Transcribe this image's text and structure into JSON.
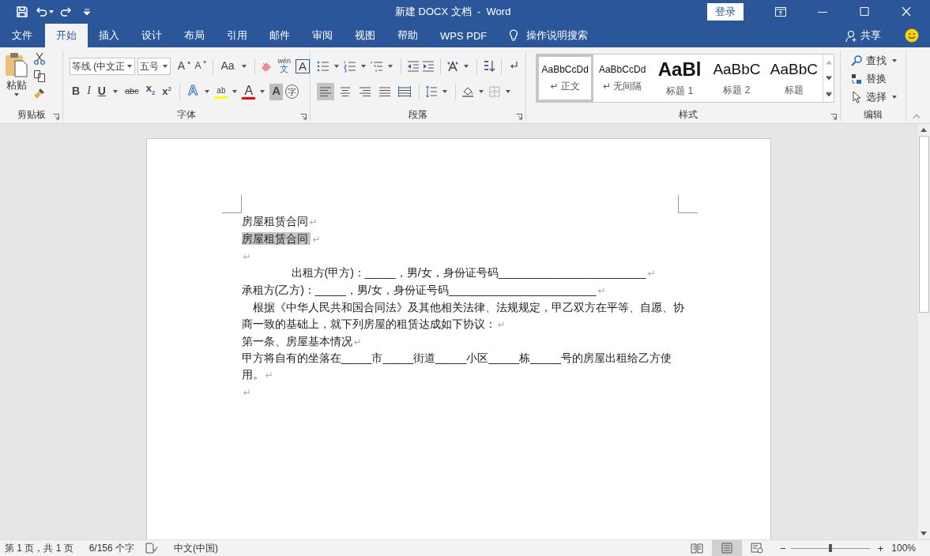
{
  "title_bar": {
    "title": "新建 DOCX 文档  -  Word",
    "login_button": "登录"
  },
  "ribbon_tabs": [
    {
      "label": "文件",
      "selected": false
    },
    {
      "label": "开始",
      "selected": true
    },
    {
      "label": "插入",
      "selected": false
    },
    {
      "label": "设计",
      "selected": false
    },
    {
      "label": "布局",
      "selected": false
    },
    {
      "label": "引用",
      "selected": false
    },
    {
      "label": "邮件",
      "selected": false
    },
    {
      "label": "审阅",
      "selected": false
    },
    {
      "label": "视图",
      "selected": false
    },
    {
      "label": "帮助",
      "selected": false
    },
    {
      "label": "WPS PDF",
      "selected": false
    }
  ],
  "tell_me": "操作说明搜索",
  "share": "共享",
  "clipboard": {
    "paste": "粘贴",
    "group": "剪贴板"
  },
  "font": {
    "name": "等线 (中文正",
    "size": "五号",
    "group": "字体",
    "row1": [
      {
        "kind": "grow",
        "glyph": "A"
      },
      {
        "kind": "shrink",
        "glyph": "A"
      },
      {
        "kind": "case",
        "glyph": "Aa"
      },
      {
        "kind": "clear"
      },
      {
        "kind": "phonetic",
        "glyph": "wén",
        "sub": "文"
      },
      {
        "kind": "border",
        "glyph": "A"
      }
    ],
    "row2": [
      {
        "kind": "bold",
        "glyph": "B"
      },
      {
        "kind": "italic",
        "glyph": "I"
      },
      {
        "kind": "underline",
        "glyph": "U"
      },
      {
        "kind": "strike",
        "glyph": "abc"
      },
      {
        "kind": "sub",
        "glyph": "x",
        "sub": "2"
      },
      {
        "kind": "sup",
        "glyph": "x",
        "sup": "2"
      },
      {
        "kind": "effects",
        "glyph": "A"
      },
      {
        "kind": "highlight",
        "glyph": "ab",
        "color": "#ffff00"
      },
      {
        "kind": "color",
        "glyph": "A",
        "color": "#ff0000"
      },
      {
        "kind": "shading",
        "glyph": "A"
      },
      {
        "kind": "enclose",
        "glyph": "字"
      }
    ]
  },
  "paragraph": {
    "group": "段落",
    "alignment": [
      {
        "kind": "left",
        "selected": true
      },
      {
        "kind": "center",
        "selected": false
      },
      {
        "kind": "right",
        "selected": false
      },
      {
        "kind": "justify",
        "selected": false
      },
      {
        "kind": "distribute",
        "selected": false
      }
    ]
  },
  "styles": {
    "group": "样式",
    "items": [
      {
        "kind": "normal",
        "preview": "AaBbCcDd",
        "label": "↵ 正文",
        "selected": true
      },
      {
        "kind": "normal",
        "preview": "AaBbCcDd",
        "label": "↵ 无间隔",
        "selected": false
      },
      {
        "kind": "h1",
        "preview": "AaBl",
        "label": "标题 1",
        "selected": false
      },
      {
        "kind": "h2",
        "preview": "AaBbC",
        "label": "标题 2",
        "selected": false
      },
      {
        "kind": "h2",
        "preview": "AaBbC",
        "label": "标题",
        "selected": false
      }
    ]
  },
  "editing": {
    "group": "编辑",
    "find": "查找",
    "replace": "替换",
    "select": "选择"
  },
  "document": [
    {
      "kind": "plain",
      "text": "房屋租赁合同",
      "mark": "↵",
      "selected": false
    },
    {
      "kind": "plain",
      "text": "房屋租赁合同 ",
      "mark": "↵",
      "selected": true
    },
    {
      "kind": "plain",
      "mark": "↵",
      "selected": false
    },
    {
      "kind": "tabbed",
      "text": "出租方(甲方)：_____，男/女，身份证号码________________________",
      "mark": "↵",
      "selected": false
    },
    {
      "kind": "plain",
      "text": "承租方(乙方)：_____，男/女，身份证号码________________________",
      "mark": "↵",
      "selected": false
    },
    {
      "kind": "first-line",
      "text": "根据《中华人民共和国合同法》及其他相关法律、法规规定，甲乙双方在平等、自愿、协商一致的基础上，就下列房屋的租赁达成如下协议：",
      "mark": "↵",
      "selected": false
    },
    {
      "kind": "plain",
      "text": "第一条、房屋基本情况",
      "mark": "↵",
      "selected": false
    },
    {
      "kind": "plain",
      "text": "甲方将自有的坐落在_____市_____街道_____小区_____栋_____号的房屋出租给乙方使用。",
      "mark": "↵",
      "selected": false
    },
    {
      "kind": "plain",
      "mark": "↵",
      "selected": false
    }
  ],
  "status_bar": {
    "page": "第 1 页，共 1 页",
    "words": "6/156 个字",
    "language": "中文(中国)",
    "views": [
      {
        "kind": "read",
        "selected": false
      },
      {
        "kind": "print",
        "selected": true
      },
      {
        "kind": "web",
        "selected": false
      }
    ],
    "zoom_out": "−",
    "zoom_in": "+",
    "zoom": {
      "level": 0.5
    },
    "zoom_text": "100%"
  }
}
